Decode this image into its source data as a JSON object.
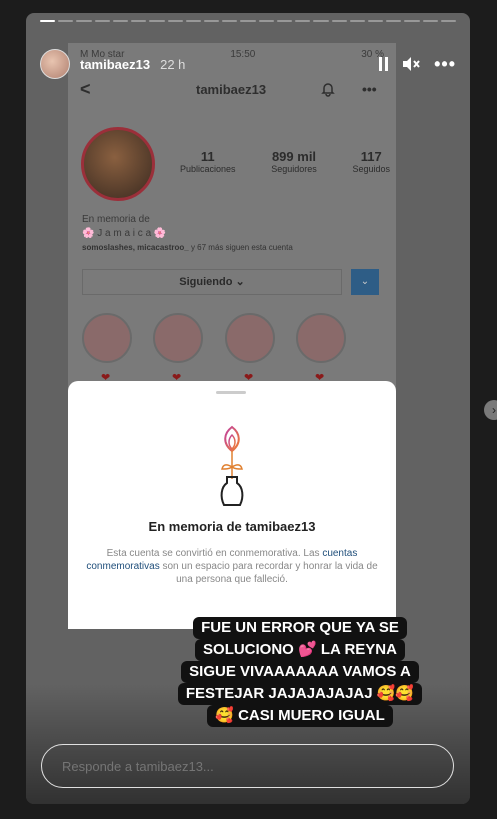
{
  "header": {
    "username": "tamibaez13",
    "time": "22 h",
    "pause_icon": "pause-icon",
    "mute_icon": "mute-icon",
    "more_label": "•••"
  },
  "progress": {
    "segments": 23,
    "active": 1
  },
  "phone": {
    "status_left": "M  Mo star",
    "status_time": "15:50",
    "status_right": "30 %",
    "back": "<",
    "username": "tamibaez13",
    "more": "•••",
    "stats": [
      {
        "num": "11",
        "label": "Publicaciones"
      },
      {
        "num": "899 mil",
        "label": "Seguidores"
      },
      {
        "num": "117",
        "label": "Seguidos"
      }
    ],
    "bio_line1": "En memoria de",
    "bio_line2": "🌸 J a m a i c a 🌸",
    "follows_names": "somoslashes, micacastroo_",
    "follows_rest": " y 67 más siguen esta cuenta",
    "button_label": "Siguiendo ⌄",
    "dropdown_label": "⌄",
    "heart": "❤"
  },
  "sheet": {
    "title": "En memoria de tamibaez13",
    "desc_part1": "Esta cuenta se convirtió en conmemorativa. Las ",
    "desc_link": "cuentas conmemorativas",
    "desc_part2": " son un espacio para recordar y honrar la vida de una persona que falleció."
  },
  "caption": {
    "line1": "FUE UN ERROR QUE YA SE",
    "line2": "SOLUCIONO 💕 LA REYNA",
    "line3": "SIGUE VIVAAAAAAA VAMOS A",
    "line4": "FESTEJAR JAJAJAJAJAJ 🥰🥰",
    "line5": "🥰 CASI MUERO IGUAL"
  },
  "reply": {
    "placeholder": "Responde a tamibaez13..."
  },
  "next_label": "›"
}
